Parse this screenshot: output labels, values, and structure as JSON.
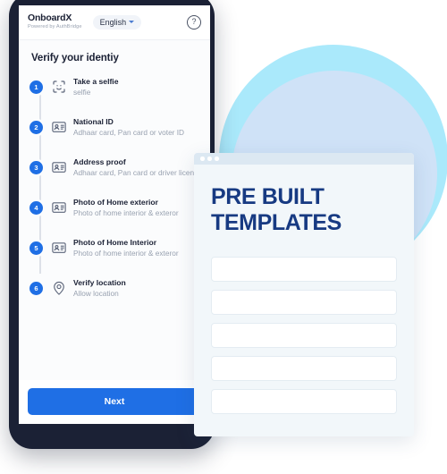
{
  "background": {
    "outer_circle_color": "#aae9fb",
    "inner_circle_color": "#cfe2f7"
  },
  "phone": {
    "frame_color": "#1b2135",
    "header": {
      "brand_name": "OnboardX",
      "brand_tagline": "Powered by AuthBridge",
      "language_selector": {
        "value": "English",
        "chevron_icon": "chevron-down-icon"
      },
      "help_icon_label": "?"
    },
    "page_title": "Verify your identiy",
    "accent_color": "#1f6fe5",
    "steps": [
      {
        "number": "1",
        "title": "Take a selfie",
        "description": "selfie",
        "icon": "face-scan-icon"
      },
      {
        "number": "2",
        "title": "National ID",
        "description": "Adhaar card, Pan card or voter ID",
        "icon": "id-card-icon"
      },
      {
        "number": "3",
        "title": "Address proof",
        "description": "Adhaar card, Pan card or driver licen",
        "icon": "id-card-icon"
      },
      {
        "number": "4",
        "title": "Photo of Home exterior",
        "description": "Photo of home interior & exteror",
        "icon": "id-card-icon"
      },
      {
        "number": "5",
        "title": "Photo of Home Interior",
        "description": "Photo of home interior & exteror",
        "icon": "id-card-icon"
      },
      {
        "number": "6",
        "title": "Verify location",
        "description": "Allow location",
        "icon": "location-pin-icon"
      }
    ],
    "footer": {
      "next_label": "Next"
    }
  },
  "templates_window": {
    "titlebar_dots": 3,
    "heading": "PRE BUILT\nTEMPLATES",
    "heading_color": "#173a82",
    "fields": [
      {
        "value": "",
        "placeholder": ""
      },
      {
        "value": "",
        "placeholder": ""
      },
      {
        "value": "",
        "placeholder": ""
      },
      {
        "value": "",
        "placeholder": ""
      },
      {
        "value": "",
        "placeholder": ""
      }
    ]
  }
}
